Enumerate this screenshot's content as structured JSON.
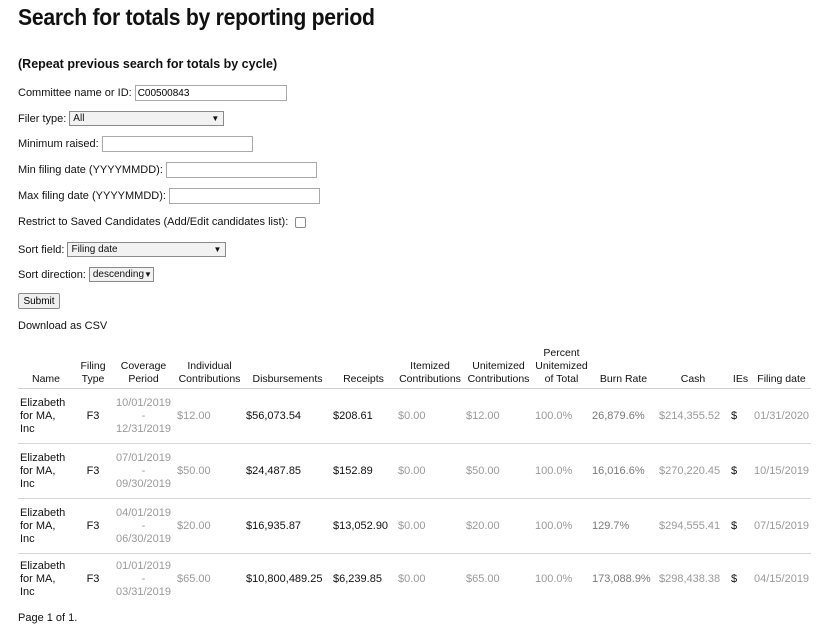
{
  "page": {
    "title": "Search for totals by reporting period",
    "repeat_link": "(Repeat previous search for totals by cycle)"
  },
  "form": {
    "committee_label": "Committee name or ID:",
    "committee_value": "C00500843",
    "filer_type_label": "Filer type:",
    "filer_type_value": "All",
    "min_raised_label": "Minimum raised:",
    "min_raised_value": "",
    "min_date_label": "Min filing date (YYYYMMDD):",
    "min_date_value": "",
    "max_date_label": "Max filing date (YYYYMMDD):",
    "max_date_value": "",
    "restrict_label": "Restrict to Saved Candidates (Add/Edit candidates list):",
    "restrict_checked": false,
    "sort_field_label": "Sort field:",
    "sort_field_value": "Filing date",
    "sort_dir_label": "Sort direction:",
    "sort_dir_value": "descending",
    "submit_label": "Submit",
    "csv_link": "Download as CSV"
  },
  "table": {
    "headers": [
      [
        "Name"
      ],
      [
        "Filing",
        "Type"
      ],
      [
        "Coverage",
        "Period"
      ],
      [
        "Individual",
        "Contributions"
      ],
      [
        "Disbursements"
      ],
      [
        "Receipts"
      ],
      [
        "Itemized",
        "Contributions"
      ],
      [
        "Unitemized",
        "Contributions"
      ],
      [
        "Percent",
        "Unitemized",
        "of Total"
      ],
      [
        "Burn Rate"
      ],
      [
        "Cash"
      ],
      [
        "IEs"
      ],
      [
        "Filing date"
      ]
    ],
    "rows": [
      {
        "name": [
          "Elizabeth",
          "for MA,",
          "Inc"
        ],
        "filing_type": "F3",
        "period": [
          "10/01/2019",
          "-",
          "12/31/2019"
        ],
        "individual": "$12.00",
        "disbursements": "$56,073.54",
        "receipts": "$208.61",
        "itemized": "$0.00",
        "unitemized": "$12.00",
        "percent": "100.0%",
        "burn_rate": "26,879.6%",
        "cash": "$214,355.52",
        "ies": "$",
        "filing_date": "01/31/2020"
      },
      {
        "name": [
          "Elizabeth",
          "for MA,",
          "Inc"
        ],
        "filing_type": "F3",
        "period": [
          "07/01/2019",
          "-",
          "09/30/2019"
        ],
        "individual": "$50.00",
        "disbursements": "$24,487.85",
        "receipts": "$152.89",
        "itemized": "$0.00",
        "unitemized": "$50.00",
        "percent": "100.0%",
        "burn_rate": "16,016.6%",
        "cash": "$270,220.45",
        "ies": "$",
        "filing_date": "10/15/2019"
      },
      {
        "name": [
          "Elizabeth",
          "for MA,",
          "Inc"
        ],
        "filing_type": "F3",
        "period": [
          "04/01/2019",
          "-",
          "06/30/2019"
        ],
        "individual": "$20.00",
        "disbursements": "$16,935.87",
        "receipts": "$13,052.90",
        "itemized": "$0.00",
        "unitemized": "$20.00",
        "percent": "100.0%",
        "burn_rate": "129.7%",
        "cash": "$294,555.41",
        "ies": "$",
        "filing_date": "07/15/2019"
      },
      {
        "name": [
          "Elizabeth",
          "for MA,",
          "Inc"
        ],
        "filing_type": "F3",
        "period": [
          "01/01/2019",
          "-",
          "03/31/2019"
        ],
        "individual": "$65.00",
        "disbursements": "$10,800,489.25",
        "receipts": "$6,239.85",
        "itemized": "$0.00",
        "unitemized": "$65.00",
        "percent": "100.0%",
        "burn_rate": "173,088.9%",
        "cash": "$298,438.38",
        "ies": "$",
        "filing_date": "04/15/2019"
      }
    ]
  },
  "footer": {
    "pagination": "Page 1 of 1."
  },
  "icons": {
    "dropdown": "chevron-down-icon"
  },
  "colors": {
    "muted_text": "#9a9a9a",
    "text": "#111111",
    "background": "#ffffff"
  }
}
